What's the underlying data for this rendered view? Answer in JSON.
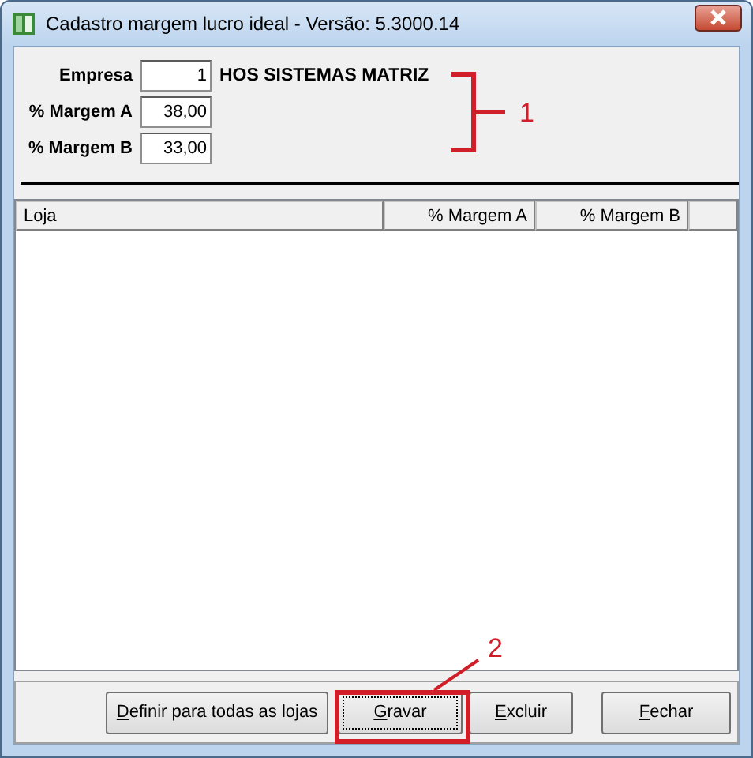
{
  "window": {
    "title": "Cadastro margem lucro ideal - Versão: 5.3000.14"
  },
  "form": {
    "fields": [
      {
        "label": "Empresa",
        "value": "1",
        "description": "HOS SISTEMAS MATRIZ"
      },
      {
        "label": "% Margem A",
        "value": "38,00"
      },
      {
        "label": "% Margem B",
        "value": "33,00"
      }
    ]
  },
  "table": {
    "columns": [
      "Loja",
      "% Margem A",
      "% Margem B"
    ]
  },
  "buttons": [
    {
      "key": "D",
      "rest": "efinir para todas as lojas",
      "focused": false
    },
    {
      "key": "G",
      "rest": "ravar",
      "focused": true
    },
    {
      "key": "E",
      "rest": "xcluir",
      "focused": false
    },
    {
      "key": "F",
      "rest": "echar",
      "focused": false
    }
  ],
  "annotations": [
    {
      "kind": "bracket",
      "label": "1"
    },
    {
      "kind": "box",
      "label": "2"
    }
  ]
}
